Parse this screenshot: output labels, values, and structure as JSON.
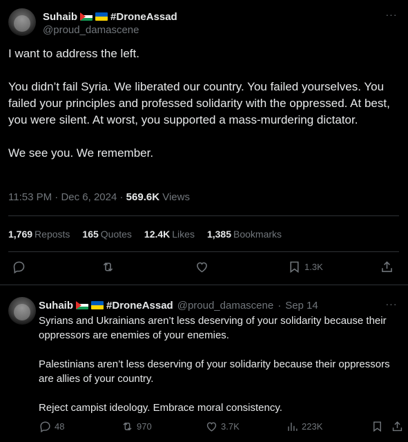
{
  "main_tweet": {
    "author": {
      "name": "Suhaib",
      "flags": [
        "palestine-flag",
        "ukraine-flag"
      ],
      "hashtag": "#DroneAssad",
      "handle": "@proud_damascene"
    },
    "paragraphs": [
      "I want to address the left.",
      "You didn’t fail Syria. We liberated our country. You failed yourselves. You failed your principles and professed solidarity with the oppressed. At best, you were silent. At worst, you supported a mass-murdering dictator.",
      "We see you. We remember."
    ],
    "time": "11:53 PM",
    "date": "Dec 6, 2024",
    "separator": "·",
    "views_count": "569.6K",
    "views_label": "Views",
    "stats": [
      {
        "num": "1,769",
        "label": "Reposts"
      },
      {
        "num": "165",
        "label": "Quotes"
      },
      {
        "num": "12.4K",
        "label": "Likes"
      },
      {
        "num": "1,385",
        "label": "Bookmarks"
      }
    ],
    "actions": {
      "bookmark_count": "1.3K"
    }
  },
  "reply_tweet": {
    "author": {
      "name": "Suhaib",
      "hashtag": "#DroneAssad",
      "handle": "@proud_damascene",
      "separator": "·",
      "date": "Sep 14"
    },
    "paragraphs": [
      "Syrians and Ukrainians aren’t less deserving of your solidarity because their oppressors are enemies of your enemies.",
      "Palestinians aren’t less deserving of your solidarity because their oppressors are allies of your country.",
      "Reject campist ideology. Embrace moral consistency."
    ],
    "actions": {
      "replies": "48",
      "reposts": "970",
      "likes": "3.7K",
      "views": "223K"
    }
  },
  "colors": {
    "background": "#000000",
    "text": "#e7e9ea",
    "muted": "#71767b",
    "divider": "#2f3336"
  }
}
